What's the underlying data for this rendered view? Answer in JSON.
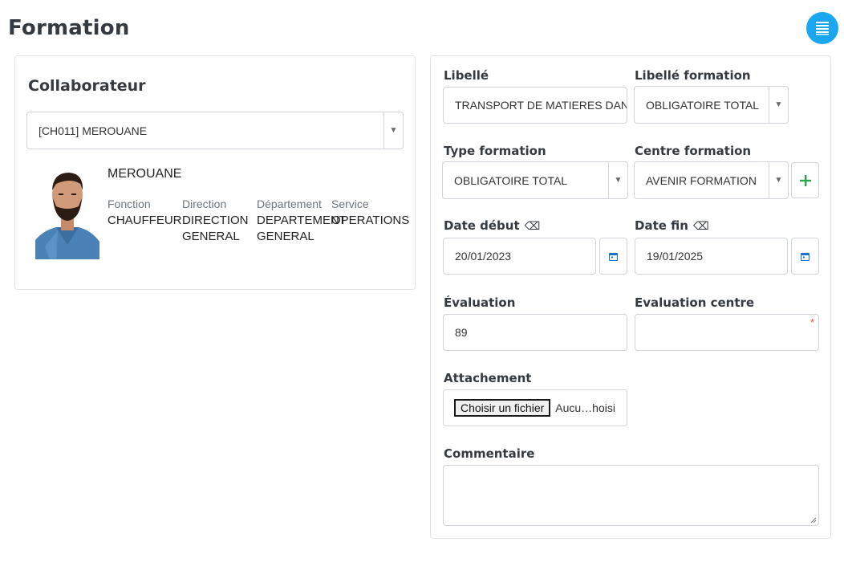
{
  "page": {
    "title": "Formation"
  },
  "header": {
    "menu_icon": "list-icon",
    "accent_color": "#1ba6f0"
  },
  "collaborateur": {
    "title": "Collaborateur",
    "select_value": "[CH011] MEROUANE",
    "name": "MEROUANE",
    "fields": [
      {
        "label": "Fonction",
        "value": "CHAUFFEUR"
      },
      {
        "label": "Direction",
        "value": "DIRECTION GENERAL"
      },
      {
        "label": "Département",
        "value": "DEPARTEMENT GENERAL"
      },
      {
        "label": "Service",
        "value": "OPERATIONS"
      }
    ]
  },
  "form": {
    "libelle": {
      "label": "Libellé",
      "value": "TRANSPORT DE MATIERES DAN"
    },
    "libelle_formation": {
      "label": "Libellé formation",
      "value": "OBLIGATOIRE TOTAL"
    },
    "type_formation": {
      "label": "Type formation",
      "value": "OBLIGATOIRE TOTAL"
    },
    "centre_formation": {
      "label": "Centre formation",
      "value": "AVENIR FORMATION"
    },
    "date_debut": {
      "label": "Date début",
      "value": "20/01/2023"
    },
    "date_fin": {
      "label": "Date fin",
      "value": "19/01/2025"
    },
    "evaluation": {
      "label": "Évaluation",
      "value": "89"
    },
    "evaluation_centre": {
      "label": "Evaluation centre",
      "value": "",
      "required_mark": "*"
    },
    "attachement": {
      "label": "Attachement",
      "button": "Choisir un fichier",
      "status": "Aucu…hoisi"
    },
    "commentaire": {
      "label": "Commentaire",
      "value": ""
    }
  }
}
